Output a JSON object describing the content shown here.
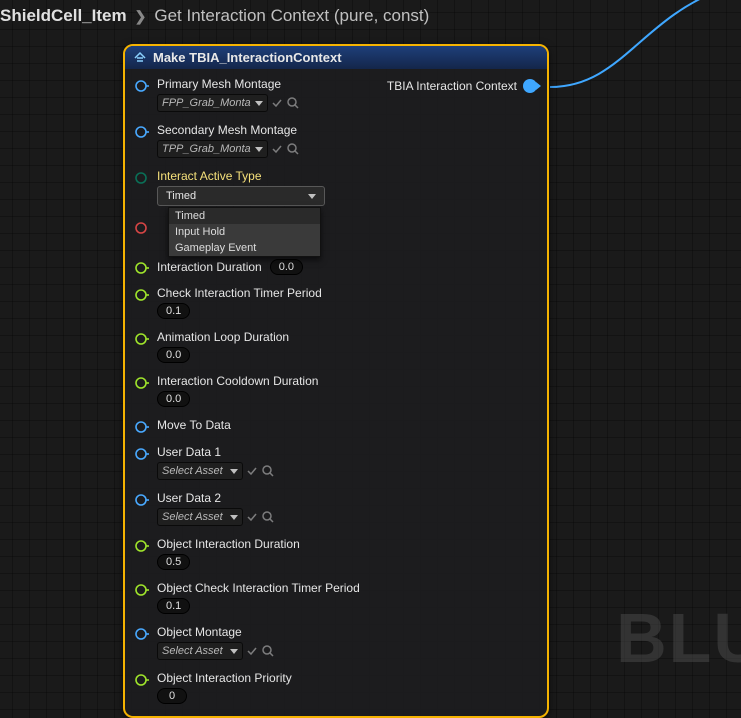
{
  "breadcrumb": {
    "item1": "ShieldCell_Item",
    "item2": "Get Interaction Context (pure, const)"
  },
  "watermark": "BLU",
  "node": {
    "title": "Make TBIA_InteractionContext",
    "output_label": "TBIA Interaction Context",
    "pins": {
      "primary_mesh": {
        "label": "Primary Mesh Montage",
        "value": "FPP_Grab_Monta"
      },
      "secondary_mesh": {
        "label": "Secondary Mesh Montage",
        "value": "TPP_Grab_Monta"
      },
      "interact_active_type": {
        "label": "Interact Active Type",
        "selected": "Timed",
        "options": [
          "Timed",
          "Input Hold",
          "Gameplay Event"
        ]
      },
      "interaction_duration": {
        "label": "Interaction Duration",
        "value": "0.0"
      },
      "check_timer": {
        "label": "Check Interaction Timer Period",
        "value": "0.1"
      },
      "anim_loop": {
        "label": "Animation Loop Duration",
        "value": "0.0"
      },
      "cooldown": {
        "label": "Interaction Cooldown Duration",
        "value": "0.0"
      },
      "move_to": {
        "label": "Move To Data"
      },
      "user1": {
        "label": "User Data 1",
        "value": "Select Asset"
      },
      "user2": {
        "label": "User Data 2",
        "value": "Select Asset"
      },
      "obj_duration": {
        "label": "Object Interaction Duration",
        "value": "0.5"
      },
      "obj_check": {
        "label": "Object Check Interaction Timer Period",
        "value": "0.1"
      },
      "obj_montage": {
        "label": "Object Montage",
        "value": "Select Asset"
      },
      "obj_priority": {
        "label": "Object Interaction Priority",
        "value": "0"
      }
    }
  }
}
